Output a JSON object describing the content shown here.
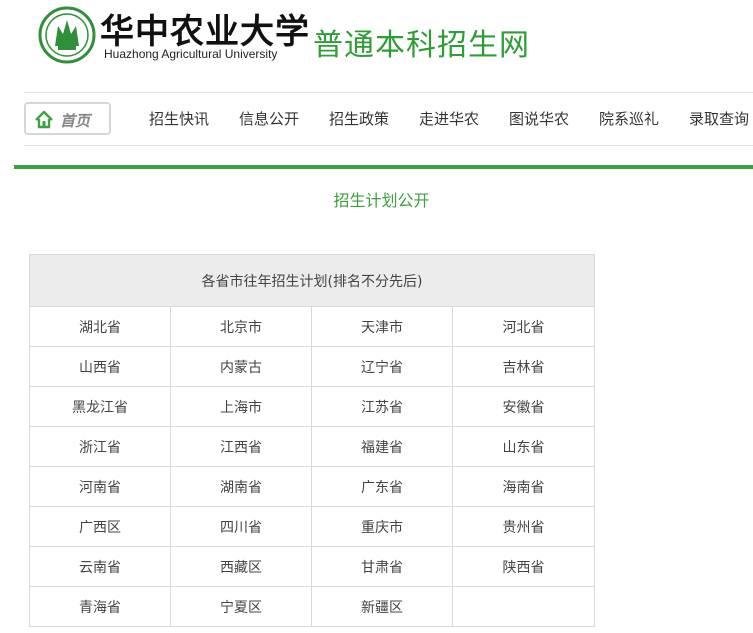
{
  "header": {
    "university_cn": "华中农业大学",
    "university_en": "Huazhong Agricultural University",
    "site_title": "普通本科招生网",
    "logo_icon": "university-seal-icon",
    "brand_color": "#2f9d35"
  },
  "nav": {
    "home_label": "首页",
    "home_icon": "home-icon",
    "items": [
      "招生快讯",
      "信息公开",
      "招生政策",
      "走进华农",
      "图说华农",
      "院系巡礼",
      "录取查询"
    ]
  },
  "main": {
    "section_title": "招生计划公开",
    "table_header": "各省市往年招生计划(排名不分先后)",
    "provinces": [
      [
        "湖北省",
        "北京市",
        "天津市",
        "河北省"
      ],
      [
        "山西省",
        "内蒙古",
        "辽宁省",
        "吉林省"
      ],
      [
        "黑龙江省",
        "上海市",
        "江苏省",
        "安徽省"
      ],
      [
        "浙江省",
        "江西省",
        "福建省",
        "山东省"
      ],
      [
        "河南省",
        "湖南省",
        "广东省",
        "海南省"
      ],
      [
        "广西区",
        "四川省",
        "重庆市",
        "贵州省"
      ],
      [
        "云南省",
        "西藏区",
        "甘肃省",
        "陕西省"
      ],
      [
        "青海省",
        "宁夏区",
        "新疆区",
        ""
      ]
    ]
  }
}
